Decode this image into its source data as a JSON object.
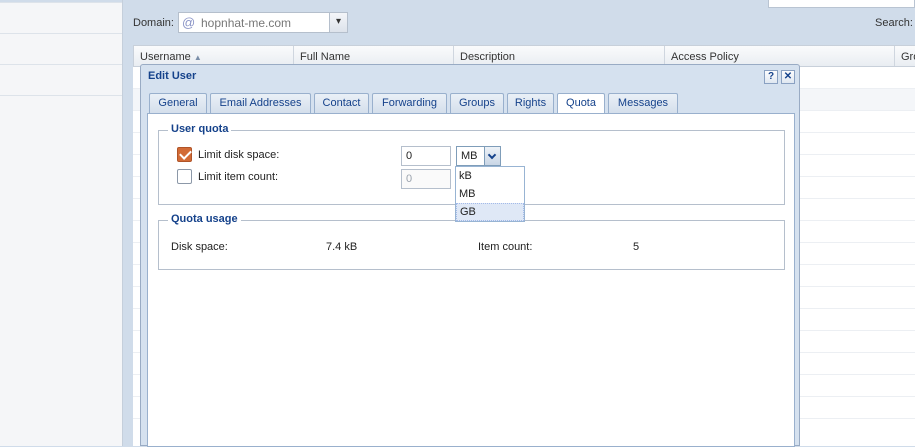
{
  "toolbar": {
    "domain_label": "Domain:",
    "domain_value": "hopnhat-me.com",
    "search_label": "Search:"
  },
  "grid": {
    "columns": [
      "Username",
      "Full Name",
      "Description",
      "Access Policy",
      "Gro"
    ]
  },
  "dialog": {
    "title": "Edit User",
    "help_tool": "?",
    "close_tool": "✕",
    "tabs": [
      "General",
      "Email Addresses",
      "Contact",
      "Forwarding",
      "Groups",
      "Rights",
      "Quota",
      "Messages"
    ],
    "active_tab": "Quota",
    "user_quota": {
      "legend": "User quota",
      "limit_disk": {
        "label": "Limit disk space:",
        "checked": true,
        "value": "0",
        "unit": "MB"
      },
      "limit_items": {
        "label": "Limit item count:",
        "checked": false,
        "value": "0"
      },
      "unit_options": [
        "kB",
        "MB",
        "GB"
      ],
      "highlighted_option": "GB"
    },
    "quota_usage": {
      "legend": "Quota usage",
      "disk_label": "Disk space:",
      "disk_value": "7.4 kB",
      "items_label": "Item count:",
      "items_value": "5"
    }
  },
  "colors": {
    "title_blue": "#15428b",
    "checkbox_orange": "#d26b36",
    "background": "#d0dcea"
  }
}
